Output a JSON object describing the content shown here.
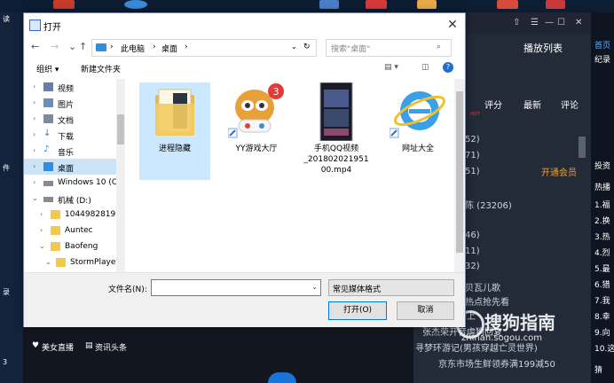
{
  "dialog": {
    "title": "打开",
    "close": "✕"
  },
  "nav": {
    "back": "←",
    "forward": "→",
    "recent": "⌄",
    "up": "↑",
    "breadcrumb": [
      "此电脑",
      "桌面"
    ],
    "sep": "›",
    "refresh": "↻",
    "search_placeholder": "搜索\"桌面\""
  },
  "toolbar": {
    "organize": "组织 ▾",
    "new_folder": "新建文件夹",
    "help": "?"
  },
  "sidebar": {
    "items": [
      {
        "label": "视频",
        "icon": "video-folder-icon",
        "color": "#6a7fa8"
      },
      {
        "label": "图片",
        "icon": "pictures-folder-icon",
        "color": "#6a8fb8"
      },
      {
        "label": "文档",
        "icon": "documents-folder-icon",
        "color": "#7a8aa0"
      },
      {
        "label": "下载",
        "icon": "downloads-folder-icon",
        "color": "#2f7ad0"
      },
      {
        "label": "音乐",
        "icon": "music-folder-icon",
        "color": "#2f7ad0"
      },
      {
        "label": "桌面",
        "icon": "desktop-folder-icon",
        "color": "#2f8ee0"
      },
      {
        "label": "Windows 10 (C",
        "icon": "drive-c-icon",
        "color": "#8a8a8a"
      },
      {
        "label": "机械 (D:)",
        "icon": "drive-d-icon",
        "color": "#8a8a8a"
      },
      {
        "label": "1044982819",
        "icon": "folder-icon",
        "color": "#f2c94c"
      },
      {
        "label": "Auntec",
        "icon": "folder-icon",
        "color": "#f2c94c"
      },
      {
        "label": "Baofeng",
        "icon": "folder-icon",
        "color": "#f2c94c"
      },
      {
        "label": "StormPlayer",
        "icon": "folder-icon",
        "color": "#f2c94c"
      }
    ]
  },
  "files": [
    {
      "name": "进程隐藏",
      "icon": "folder-icon"
    },
    {
      "name": "YY游戏大厅",
      "icon": "yy-game-icon",
      "badge": "3"
    },
    {
      "name": "手机QQ视频_20180202195100.mp4",
      "name_lines": [
        "手机QQ视频",
        "_201802021951",
        "00.mp4"
      ],
      "icon": "video-thumbnail-icon"
    },
    {
      "name": "网址大全",
      "icon": "ie-browser-icon"
    }
  ],
  "footer": {
    "filename_label": "文件名(N):",
    "filename_value": "",
    "filetype_value": "常见媒体格式",
    "open_label": "打开(O)",
    "cancel_label": "取消"
  },
  "background": {
    "left_labels": [
      "读",
      "件",
      "录",
      "3"
    ],
    "bottom_links": [
      "美女直播",
      "资讯头条"
    ],
    "player": {
      "tab_playlist": "播放列表",
      "cols": [
        "评分",
        "最新",
        "评论"
      ],
      "rows": [
        "52)",
        "71)",
        "51)",
        "陈 (23206)",
        "46)",
        "11)",
        "32)",
        "贝瓦儿歌",
        "热点抢先看",
        "天天向上",
        "张杰荣开音虐狗回复",
        "寻梦环游记(男孩穿越亡灵世界)",
        "京东市场生鲜领券满199减50"
      ],
      "vip": "开通会员"
    },
    "right_labels": [
      "首页",
      "纪录",
      "投资",
      "热播",
      "1.福",
      "2.换",
      "3.热",
      "4.烈",
      "5.最",
      "6.猎",
      "7.我",
      "8.幸",
      "9.向",
      "10.这",
      "猜"
    ],
    "watermark": "搜狗指南",
    "watermark_sub": "zhinan.sogou.com",
    "accent": "#0078d7"
  }
}
